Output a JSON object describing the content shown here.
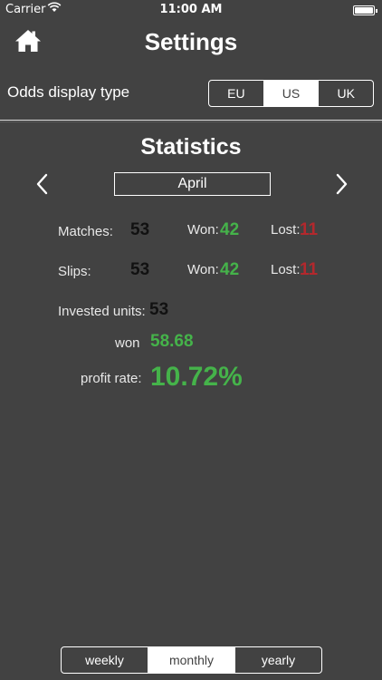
{
  "status_bar": {
    "carrier": "Carrier",
    "time": "11:00 AM"
  },
  "nav": {
    "title": "Settings",
    "home_icon": "home-icon"
  },
  "odds": {
    "label": "Odds display type",
    "options": [
      "EU",
      "US",
      "UK"
    ],
    "selected": "US"
  },
  "stats": {
    "title": "Statistics",
    "month": "April",
    "matches": {
      "label": "Matches:",
      "value": "53",
      "won_label": "Won:",
      "won": "42",
      "lost_label": "Lost:",
      "lost": "11"
    },
    "slips": {
      "label": "Slips:",
      "value": "53",
      "won_label": "Won:",
      "won": "42",
      "lost_label": "Lost:",
      "lost": "11"
    },
    "invested": {
      "label": "Invested units:",
      "value": "53"
    },
    "won": {
      "label": "won",
      "value": "58.68"
    },
    "profit": {
      "label": "profit rate:",
      "value": "10.72%"
    }
  },
  "period_tabs": {
    "options": [
      "weekly",
      "monthly",
      "yearly"
    ],
    "selected": "monthly"
  },
  "colors": {
    "background": "#424242",
    "positive": "#45b34a",
    "negative": "#b3282d"
  }
}
